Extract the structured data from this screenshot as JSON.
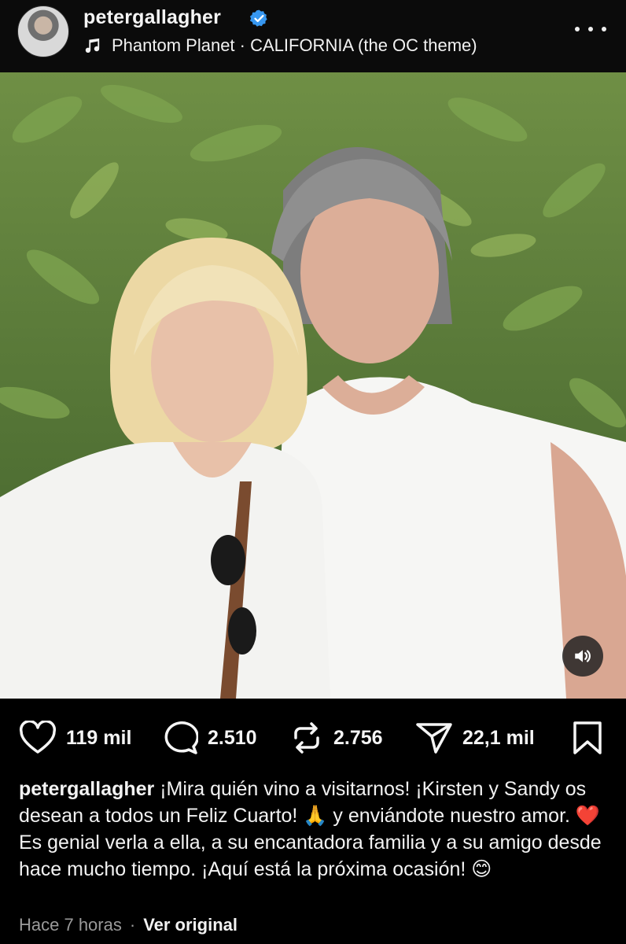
{
  "header": {
    "username": "petergallagher",
    "verified": true,
    "track": "Phantom Planet · CALIFORNIA (the OC theme)",
    "icons": {
      "music": "music-note-icon",
      "more": "more-horizontal-icon"
    }
  },
  "media": {
    "audio_icon": "speaker-volume-icon"
  },
  "actions": {
    "likes": "119 mil",
    "comments": "2.510",
    "reposts": "2.756",
    "shares": "22,1 mil"
  },
  "caption": {
    "username": "petergallagher",
    "text": " ¡Mira quién vino a visitarnos! ¡Kirsten y Sandy os desean a todos un Feliz Cuarto! 🙏 y enviándote nuestro amor. ❤️ Es genial verla a ella, a su encantadora familia y a su amigo desde hace mucho tiempo. ¡Aquí está la próxima ocasión! 😊"
  },
  "meta": {
    "time": "Hace 7 horas",
    "separator": "·",
    "translate_label": "Ver original"
  },
  "colors": {
    "background": "#000000",
    "verified_blue": "#3797f0",
    "muted_text": "#9a9a9a"
  }
}
